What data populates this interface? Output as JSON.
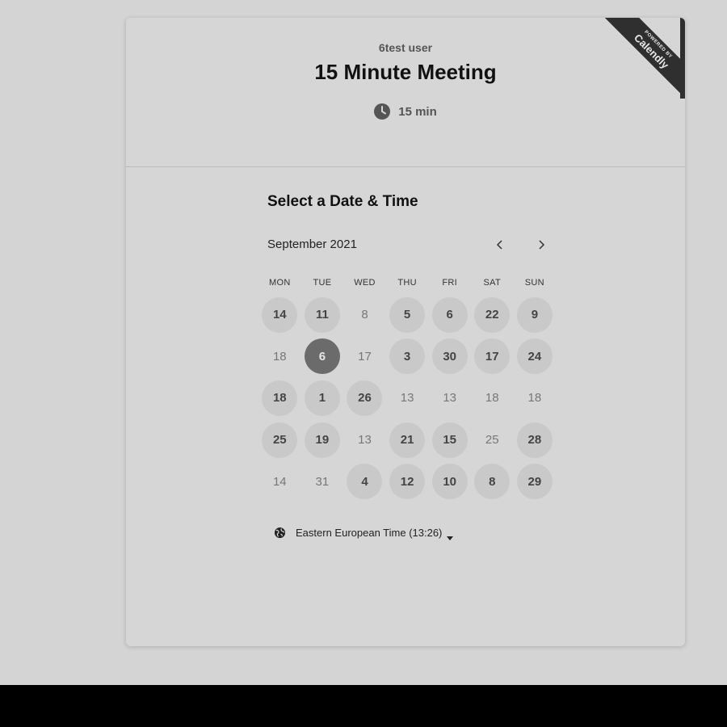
{
  "header": {
    "host_name": "6test user",
    "event_title": "15 Minute Meeting",
    "duration": "15 min",
    "duration_icon": "clock-icon"
  },
  "badge": {
    "top_text": "POWERED BY",
    "brand_text": "Calendly"
  },
  "calendar": {
    "section_title": "Select a Date & Time",
    "month_label": "September 2021",
    "prev_icon": "chevron-left-icon",
    "next_icon": "chevron-right-icon",
    "weekdays": [
      "MON",
      "TUE",
      "WED",
      "THU",
      "FRI",
      "SAT",
      "SUN"
    ],
    "weeks": [
      [
        {
          "label": "14",
          "state": "available"
        },
        {
          "label": "11",
          "state": "available"
        },
        {
          "label": "8",
          "state": "unavailable"
        },
        {
          "label": "5",
          "state": "available"
        },
        {
          "label": "6",
          "state": "available"
        },
        {
          "label": "22",
          "state": "available"
        },
        {
          "label": "9",
          "state": "available"
        }
      ],
      [
        {
          "label": "18",
          "state": "unavailable"
        },
        {
          "label": "6",
          "state": "selected"
        },
        {
          "label": "17",
          "state": "unavailable"
        },
        {
          "label": "3",
          "state": "available"
        },
        {
          "label": "30",
          "state": "available"
        },
        {
          "label": "17",
          "state": "available"
        },
        {
          "label": "24",
          "state": "available"
        }
      ],
      [
        {
          "label": "18",
          "state": "available"
        },
        {
          "label": "1",
          "state": "available"
        },
        {
          "label": "26",
          "state": "available"
        },
        {
          "label": "13",
          "state": "unavailable"
        },
        {
          "label": "13",
          "state": "unavailable"
        },
        {
          "label": "18",
          "state": "unavailable"
        },
        {
          "label": "18",
          "state": "unavailable"
        }
      ],
      [
        {
          "label": "25",
          "state": "available"
        },
        {
          "label": "19",
          "state": "available"
        },
        {
          "label": "13",
          "state": "unavailable"
        },
        {
          "label": "21",
          "state": "available"
        },
        {
          "label": "15",
          "state": "available"
        },
        {
          "label": "25",
          "state": "unavailable"
        },
        {
          "label": "28",
          "state": "available"
        }
      ],
      [
        {
          "label": "14",
          "state": "unavailable"
        },
        {
          "label": "31",
          "state": "unavailable"
        },
        {
          "label": "4",
          "state": "available"
        },
        {
          "label": "12",
          "state": "available"
        },
        {
          "label": "10",
          "state": "available"
        },
        {
          "label": "8",
          "state": "available"
        },
        {
          "label": "29",
          "state": "available"
        }
      ]
    ]
  },
  "timezone": {
    "label": "Eastern European Time (13:26)",
    "icon": "globe-icon",
    "dropdown_icon": "caret-down-icon"
  },
  "colors": {
    "page_background": "#d4d4d4",
    "available_day_bg": "#c9c9c9",
    "selected_day_bg": "#6b6b6b",
    "badge_bg": "#2f2f2f"
  }
}
